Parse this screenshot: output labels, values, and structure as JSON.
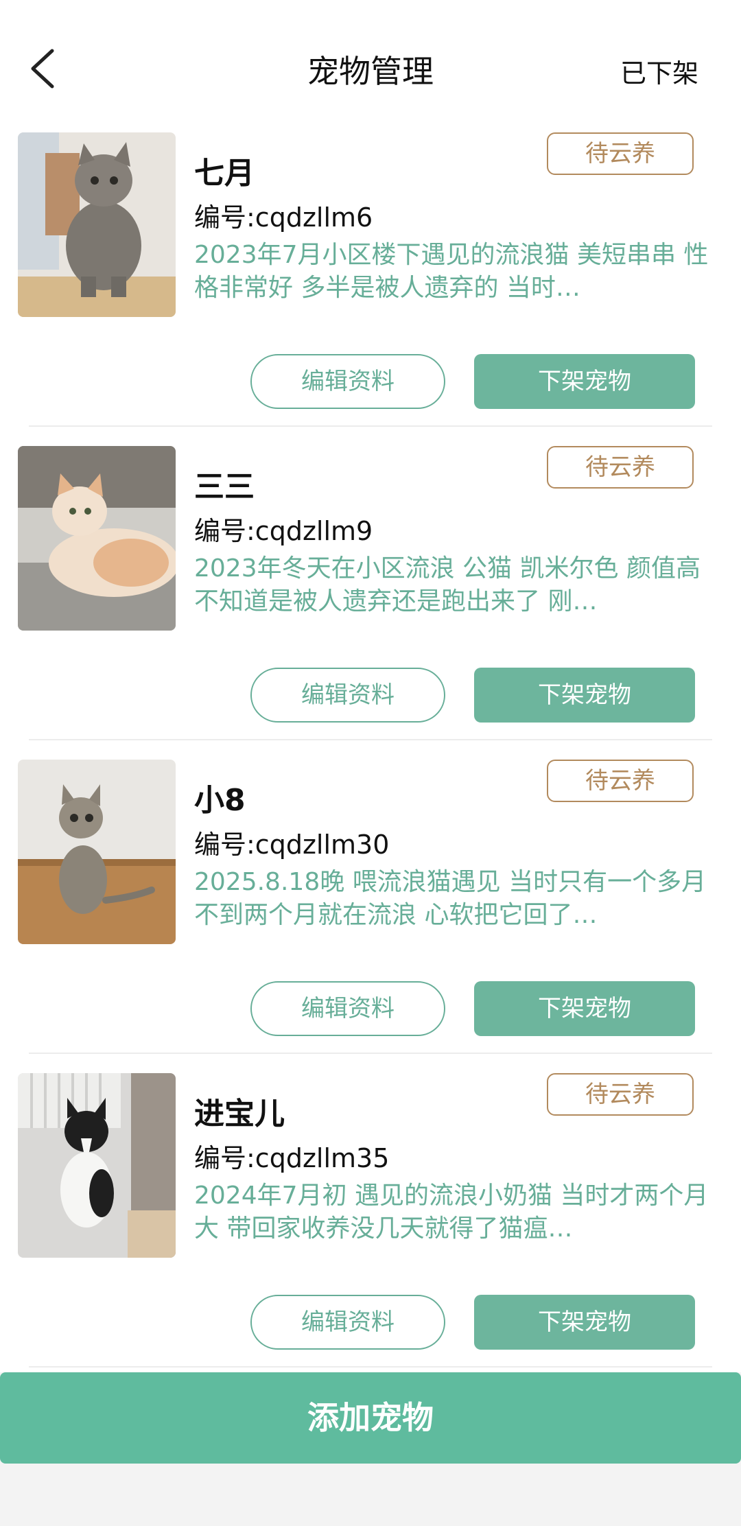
{
  "header": {
    "title": "宠物管理",
    "offshelf_link": "已下架"
  },
  "pets": [
    {
      "name": "七月",
      "code": "编号:cqdzllm6",
      "description": "2023年7月小区楼下遇见的流浪猫  美短串串  性格非常好 多半是被人遗弃的  当时…",
      "status": "待云养",
      "edit_label": "编辑资料",
      "offshelf_label": "下架宠物"
    },
    {
      "name": "三三",
      "code": "编号:cqdzllm9",
      "description": "2023年冬天在小区流浪  公猫 凯米尔色 颜值高 不知道是被人遗弃还是跑出来了  刚…",
      "status": "待云养",
      "edit_label": "编辑资料",
      "offshelf_label": "下架宠物"
    },
    {
      "name": "小8",
      "code": "编号:cqdzllm30",
      "description": "2025.8.18晚 喂流浪猫遇见 当时只有一个多月不到两个月就在流浪 心软把它回了…",
      "status": "待云养",
      "edit_label": "编辑资料",
      "offshelf_label": "下架宠物"
    },
    {
      "name": "进宝儿",
      "code": "编号:cqdzllm35",
      "description": "2024年7月初  遇见的流浪小奶猫  当时才两个月大  带回家收养没几天就得了猫瘟…",
      "status": "待云养",
      "edit_label": "编辑资料",
      "offshelf_label": "下架宠物"
    }
  ],
  "footer": {
    "add_label": "添加宠物"
  },
  "colors": {
    "accent": "#6db59d",
    "add_button": "#5fbb9e",
    "status": "#b28a5d",
    "description": "#67ae98"
  }
}
